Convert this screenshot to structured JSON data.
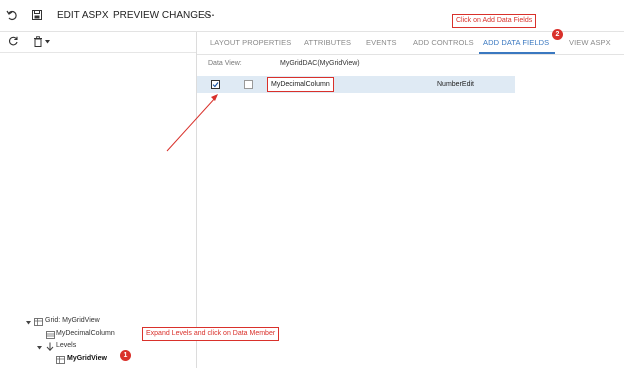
{
  "toolbar": {
    "undo_icon": "undo-icon",
    "save_icon": "save-icon",
    "edit_aspx": "EDIT ASPX",
    "preview_changes": "PREVIEW CHANGES",
    "more": "⋯"
  },
  "left_toolbar": {
    "refresh_icon": "refresh-icon",
    "delete_icon": "trash-icon"
  },
  "tabs": [
    {
      "label": "LAYOUT PROPERTIES",
      "active": false
    },
    {
      "label": "ATTRIBUTES",
      "active": false
    },
    {
      "label": "EVENTS",
      "active": false
    },
    {
      "label": "ADD CONTROLS",
      "active": false
    },
    {
      "label": "ADD DATA FIELDS",
      "active": true
    },
    {
      "label": "VIEW ASPX",
      "active": false
    }
  ],
  "data_view": {
    "label": "Data View:",
    "value": "MyGridDAC(MyGridView)"
  },
  "fields": [
    {
      "checked": true,
      "selected": false,
      "name": "MyDecimalColumn",
      "control": "NumberEdit"
    }
  ],
  "tree": {
    "grid": "Grid: MyGridView",
    "column": "MyDecimalColumn",
    "levels": "Levels",
    "member": "MyGridView"
  },
  "callouts": {
    "step1": {
      "number": "1",
      "text": "Expand Levels and click on Data Member"
    },
    "step2": {
      "number": "2",
      "text": "Click on Add Data Fields"
    }
  },
  "colors": {
    "accent": "#3a78c0",
    "annotation": "#d9312b",
    "row_selected": "#dfeaf4"
  }
}
